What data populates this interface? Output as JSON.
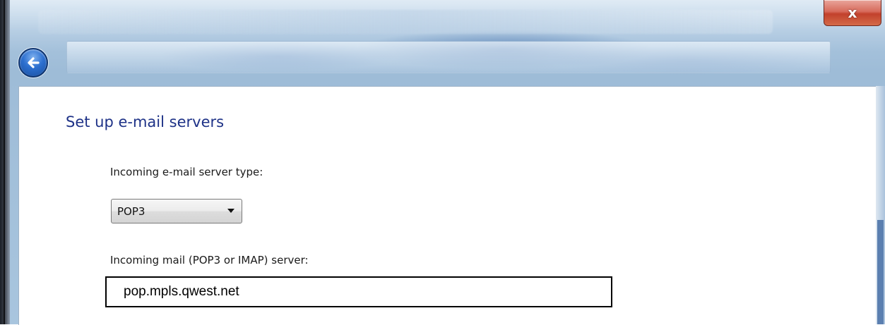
{
  "window": {
    "close_glyph": "x",
    "back_icon": "back-arrow-icon"
  },
  "page": {
    "title": "Set up e-mail servers"
  },
  "incoming_type": {
    "label": "Incoming e-mail server type:",
    "selected": "POP3"
  },
  "incoming_server": {
    "label": "Incoming mail (POP3 or IMAP) server:",
    "value": "pop.mpls.qwest.net"
  },
  "colors": {
    "title": "#1e3287",
    "close_button": "#c2412c",
    "back_button": "#2c6fcf"
  }
}
